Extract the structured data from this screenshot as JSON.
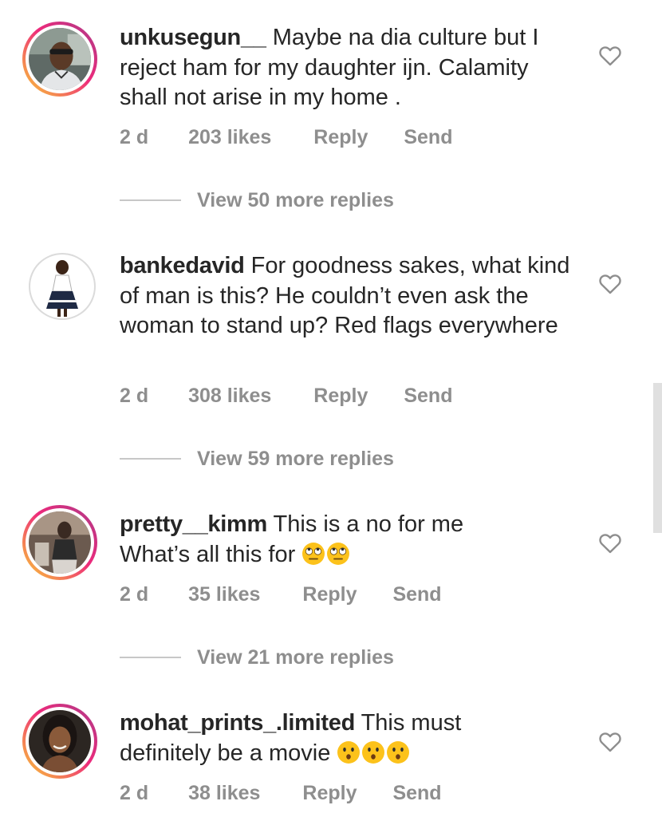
{
  "comments": [
    {
      "username": "unkusegun__",
      "text": "Maybe na dia culture but I reject ham for my daughter ijn. Calamity shall not arise in my home .",
      "time": "2 d",
      "likes": "203 likes",
      "reply_label": "Reply",
      "send_label": "Send",
      "view_replies": "View 50 more replies"
    },
    {
      "username": "bankedavid",
      "text": "For goodness sakes, what kind of man is this? He couldn’t even ask the woman to stand up? Red flags everywhere",
      "time": "2 d",
      "likes": "308 likes",
      "reply_label": "Reply",
      "send_label": "Send",
      "view_replies": "View 59 more replies"
    },
    {
      "username": "pretty__kimm",
      "text": "This is a no for me What’s all this for",
      "emoji": "face-with-rolling-eyes",
      "time": "2 d",
      "likes": "35 likes",
      "reply_label": "Reply",
      "send_label": "Send",
      "view_replies": "View 21 more replies"
    },
    {
      "username": "mohat_prints_.limited",
      "text": "This must definitely be a movie",
      "emoji": "hushed-face",
      "time": "2 d",
      "likes": "38 likes",
      "reply_label": "Reply",
      "send_label": "Send"
    }
  ],
  "colors": {
    "text": "#262626",
    "secondary": "#8e8e8e",
    "divider": "#c7c7c7",
    "story_ring_start": "#f9ce34",
    "story_ring_mid": "#ee2a7b",
    "story_ring_end": "#833ab4"
  },
  "icons": {
    "like": "heart-outline-icon"
  }
}
